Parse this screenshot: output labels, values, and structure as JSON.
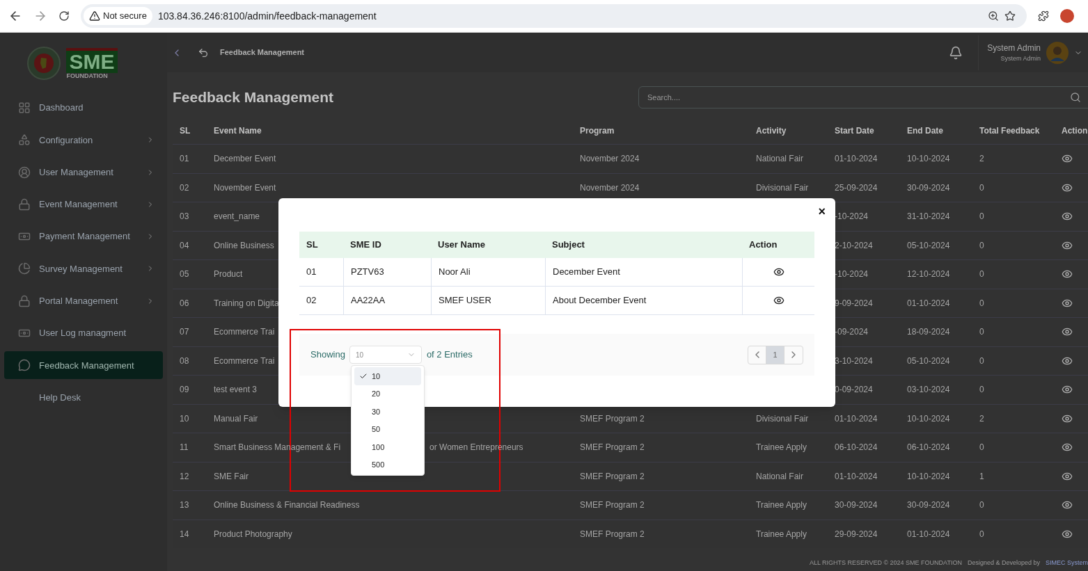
{
  "browser": {
    "security": "Not secure",
    "url": "103.84.36.246:8100/admin/feedback-management"
  },
  "logo": {
    "mark": "SME",
    "sub": "FOUNDATION"
  },
  "sidebar": {
    "items": [
      {
        "label": "Dashboard",
        "has_submenu": false,
        "selected": false
      },
      {
        "label": "Configuration",
        "has_submenu": true,
        "selected": false
      },
      {
        "label": "User Management",
        "has_submenu": true,
        "selected": false
      },
      {
        "label": "Event Management",
        "has_submenu": true,
        "selected": false
      },
      {
        "label": "Payment Management",
        "has_submenu": true,
        "selected": false
      },
      {
        "label": "Survey Management",
        "has_submenu": true,
        "selected": false
      },
      {
        "label": "Portal Management",
        "has_submenu": true,
        "selected": false
      },
      {
        "label": "User Log managment",
        "has_submenu": false,
        "selected": false
      },
      {
        "label": "Feedback Management",
        "has_submenu": false,
        "selected": true
      },
      {
        "label": "Help Desk",
        "has_submenu": false,
        "selected": false
      }
    ]
  },
  "header": {
    "breadcrumb": "Feedback Management",
    "user": {
      "name": "System Admin",
      "role": "System Admin"
    }
  },
  "page": {
    "title": "Feedback Management",
    "search": {
      "placeholder": "Search...."
    }
  },
  "table": {
    "columns": [
      "SL",
      "Event Name",
      "Program",
      "Activity",
      "Start Date",
      "End Date",
      "Total Feedback",
      "Action"
    ],
    "rows": [
      {
        "sl": "01",
        "event_name": "December Event",
        "program": "November 2024",
        "activity": "National Fair",
        "start_date": "01-10-2024",
        "end_date": "10-10-2024",
        "total_feedback": "2"
      },
      {
        "sl": "02",
        "event_name": "November Event",
        "program": "November 2024",
        "activity": "Divisional Fair",
        "start_date": "25-09-2024",
        "end_date": "30-09-2024",
        "total_feedback": "0"
      },
      {
        "sl": "03",
        "event_name": "event_name",
        "start_date": "-10-2024",
        "end_date": "31-10-2024",
        "total_feedback": "0"
      },
      {
        "sl": "04",
        "event_name": "Online Business",
        "start_date": "2-10-2024",
        "end_date": "05-10-2024",
        "total_feedback": "0"
      },
      {
        "sl": "05",
        "event_name": "Product",
        "start_date": "-10-2024",
        "end_date": "12-10-2024",
        "total_feedback": "0"
      },
      {
        "sl": "06",
        "event_name": "Training on Digita",
        "start_date": "9-09-2024",
        "end_date": "01-10-2024",
        "total_feedback": "0"
      },
      {
        "sl": "07",
        "event_name": "Ecommerce Trai",
        "start_date": "-09-2024",
        "end_date": "18-09-2024",
        "total_feedback": "0"
      },
      {
        "sl": "08",
        "event_name": "Ecommerce Trai",
        "start_date": "3-10-2024",
        "end_date": "05-10-2024",
        "total_feedback": "0"
      },
      {
        "sl": "09",
        "event_name": "test event 3",
        "start_date": "0-09-2024",
        "end_date": "03-10-2024",
        "total_feedback": "0"
      },
      {
        "sl": "10",
        "event_name": "Manual Fair",
        "program": "SMEF Program 2",
        "activity": "Divisional Fair",
        "start_date": "01-10-2024",
        "end_date": "10-10-2024",
        "total_feedback": "2"
      },
      {
        "sl": "11",
        "event_name": "Smart Business Management & Fi",
        "event_name_after": "or Women Entrepreneurs",
        "program": "SMEF Program 2",
        "activity": "Trainee Apply",
        "start_date": "06-10-2024",
        "end_date": "06-10-2024",
        "total_feedback": "0"
      },
      {
        "sl": "12",
        "event_name": "SME Fair",
        "program": "SMEF Program 2",
        "activity": "National Fair",
        "start_date": "01-10-2024",
        "end_date": "10-10-2024",
        "total_feedback": "1"
      },
      {
        "sl": "13",
        "event_name": "Online Business & Financial Readiness",
        "program": "SMEF Program 2",
        "activity": "Trainee Apply",
        "start_date": "30-09-2024",
        "end_date": "30-09-2024",
        "total_feedback": "0"
      },
      {
        "sl": "14",
        "event_name": "Product Photography",
        "program": "SMEF Program 2",
        "activity": "Trainee Apply",
        "start_date": "29-09-2024",
        "end_date": "01-10-2024",
        "total_feedback": "0"
      }
    ]
  },
  "modal": {
    "close": "×",
    "columns": [
      "SL",
      "SME ID",
      "User Name",
      "Subject",
      "Action"
    ],
    "rows": [
      {
        "sl": "01",
        "sme_id": "PZTV63",
        "user_name": "Noor Ali",
        "subject": "December Event"
      },
      {
        "sl": "02",
        "sme_id": "AA22AA",
        "user_name": "SMEF USER",
        "subject": "About December Event"
      }
    ],
    "pagination": {
      "label_before": "Showing",
      "page_size": "10",
      "label_after": "of 2 Entries",
      "pages": [
        {
          "label": "1",
          "selected": true
        }
      ]
    },
    "dropdown": {
      "options": [
        {
          "label": "10",
          "selected": true
        },
        {
          "label": "20",
          "selected": false
        },
        {
          "label": "30",
          "selected": false
        },
        {
          "label": "50",
          "selected": false
        },
        {
          "label": "100",
          "selected": false
        },
        {
          "label": "500",
          "selected": false
        }
      ]
    }
  },
  "footer": {
    "copyright": "ALL RIGHTS RESERVED © 2024 SME FOUNDATION",
    "credit": "Designed & Developed by",
    "developer": "SIMEC System"
  }
}
